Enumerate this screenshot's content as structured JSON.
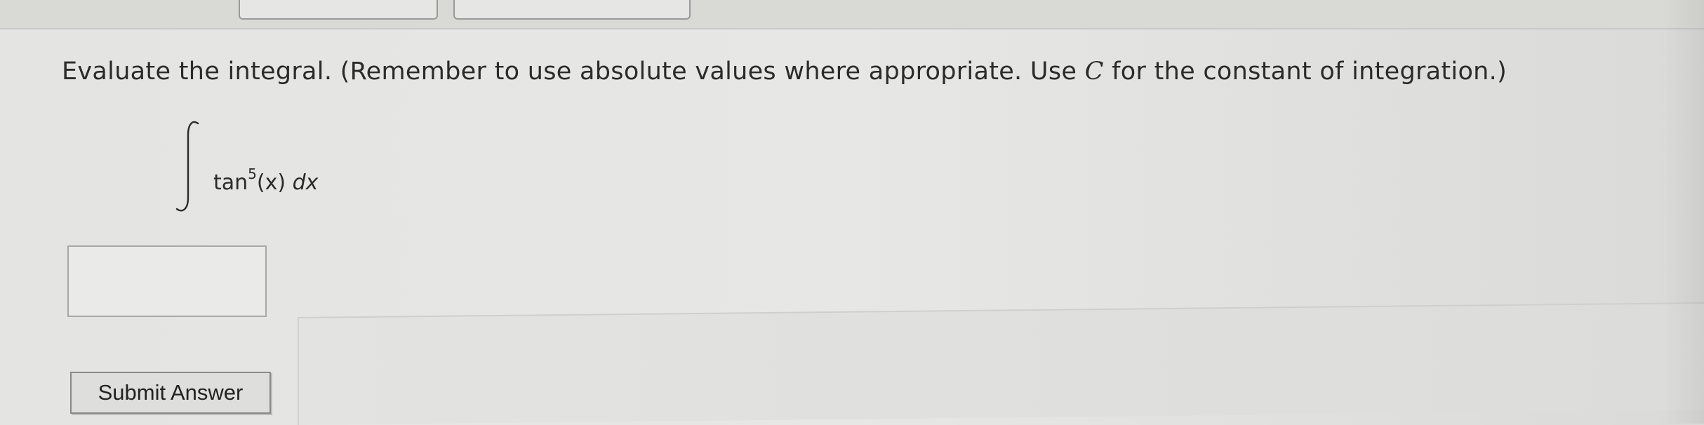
{
  "question": {
    "prompt_before_c": "Evaluate the integral. (Remember to use absolute values where appropriate. Use ",
    "constant_symbol": "C",
    "prompt_after_c": " for the constant of integration.)",
    "integral_symbol": "∫",
    "integrand_func": "tan",
    "integrand_power": "5",
    "integrand_arg": "(x)",
    "integrand_diff": "dx"
  },
  "answer": {
    "value": ""
  },
  "actions": {
    "submit_label": "Submit Answer"
  }
}
